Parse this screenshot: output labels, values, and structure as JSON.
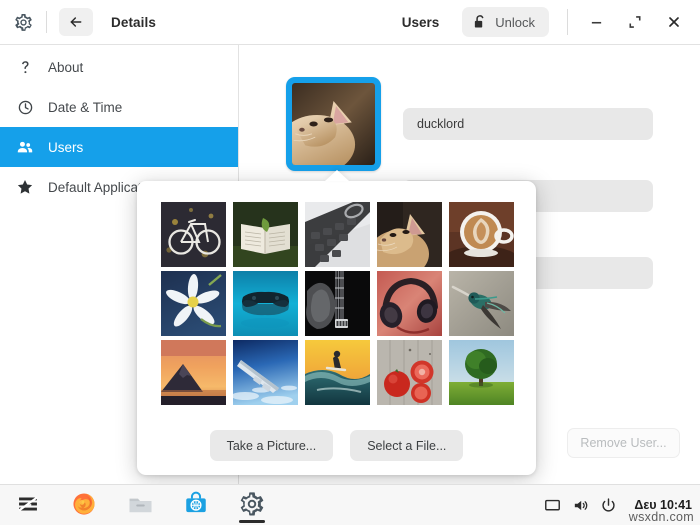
{
  "window": {
    "gear_icon": "gear-icon",
    "back_icon": "back-arrow-icon",
    "title_left": "Details",
    "title_right": "Users",
    "unlock_label": "Unlock",
    "unlock_icon": "open-padlock-icon",
    "minimize_icon": "minimize-icon",
    "maximize_icon": "restore-icon",
    "close_icon": "close-icon"
  },
  "sidebar": {
    "items": [
      {
        "label": "About",
        "icon": "question-mark-icon",
        "active": false
      },
      {
        "label": "Date & Time",
        "icon": "clock-icon",
        "active": false
      },
      {
        "label": "Users",
        "icon": "people-icon",
        "active": true
      },
      {
        "label": "Default Applications",
        "icon": "star-icon",
        "active": false
      }
    ]
  },
  "content": {
    "avatar": {
      "name": "user-avatar",
      "image": "cat-looking-up-photo",
      "selected": true,
      "border_color": "#15a0ea"
    },
    "username_value": "ducklord",
    "remove_user_label": "Remove User...",
    "remove_user_disabled": true
  },
  "avatar_popup": {
    "take_picture_label": "Take a Picture...",
    "select_file_label": "Select a File...",
    "grid": [
      {
        "name": "bicycle-avatar",
        "alt": "white bicycle on dark ground"
      },
      {
        "name": "open-book-avatar",
        "alt": "open book with leaf on grass"
      },
      {
        "name": "calculator-avatar",
        "alt": "black calculator keypad"
      },
      {
        "name": "cat-avatar",
        "alt": "tabby cat looking up"
      },
      {
        "name": "latte-avatar",
        "alt": "latte art coffee cup"
      },
      {
        "name": "flower-avatar",
        "alt": "white flower on blue"
      },
      {
        "name": "controller-avatar",
        "alt": "game controller in water"
      },
      {
        "name": "bass-guitar-avatar",
        "alt": "black bass guitar body"
      },
      {
        "name": "headphones-avatar",
        "alt": "headphones on red background"
      },
      {
        "name": "hummingbird-avatar",
        "alt": "green hummingbird in flight"
      },
      {
        "name": "mountain-avatar",
        "alt": "mountain at orange sunset"
      },
      {
        "name": "airplane-wing-avatar",
        "alt": "airplane wing above clouds"
      },
      {
        "name": "surfer-avatar",
        "alt": "surfer on wave at sunset"
      },
      {
        "name": "tomatoes-avatar",
        "alt": "tomatoes on grey wood"
      },
      {
        "name": "tree-avatar",
        "alt": "green tree in a field"
      }
    ]
  },
  "taskbar": {
    "apps": [
      {
        "name": "zorin-menu-icon",
        "label": "Zorin Menu",
        "running": false
      },
      {
        "name": "firefox-icon",
        "label": "Firefox",
        "running": false
      },
      {
        "name": "files-icon",
        "label": "Files",
        "running": false
      },
      {
        "name": "software-icon",
        "label": "Software",
        "running": false
      },
      {
        "name": "settings-icon",
        "label": "Settings",
        "running": true
      }
    ],
    "tray": [
      {
        "name": "display-icon",
        "label": "Display"
      },
      {
        "name": "volume-icon",
        "label": "Volume"
      },
      {
        "name": "power-icon",
        "label": "Power"
      }
    ],
    "clock": "Δευ 10:41",
    "watermark": "wsxdn.com"
  }
}
